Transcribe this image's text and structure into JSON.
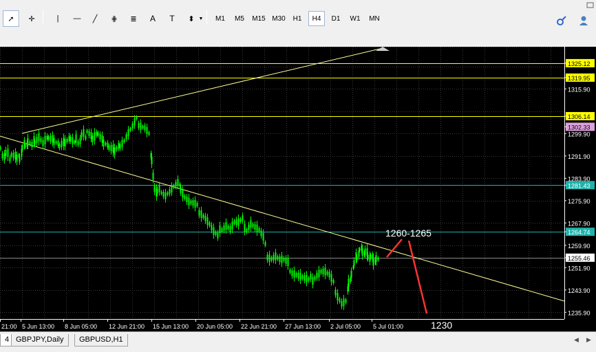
{
  "toolbar": {
    "tools": [
      {
        "name": "cursor-tool",
        "glyph": "➚"
      },
      {
        "name": "crosshair-tool",
        "glyph": "✛"
      },
      {
        "name": "vertical-line-tool",
        "glyph": "|"
      },
      {
        "name": "horizontal-line-tool",
        "glyph": "—"
      },
      {
        "name": "trendline-tool",
        "glyph": "╱"
      },
      {
        "name": "equidistant-channel-tool",
        "glyph": "⋕"
      },
      {
        "name": "fibonacci-tool",
        "glyph": "≣"
      },
      {
        "name": "text-tool",
        "glyph": "A"
      },
      {
        "name": "text-label-tool",
        "glyph": "T"
      },
      {
        "name": "arrows-tool",
        "glyph": "⬍"
      }
    ],
    "timeframes": [
      "M1",
      "M5",
      "M15",
      "M30",
      "H1",
      "H4",
      "D1",
      "W1",
      "MN"
    ],
    "active_timeframe": "H4"
  },
  "chart": {
    "price_labels": [
      {
        "text": "1325.12",
        "bg": "#ffff00",
        "fg": "#000000",
        "price": 1325.12
      },
      {
        "text": "1319.95",
        "bg": "#ffff00",
        "fg": "#000000",
        "price": 1319.95
      },
      {
        "text": "1315.90",
        "bg": "",
        "fg": "#ffffff",
        "price": 1315.9
      },
      {
        "text": "1306.14",
        "bg": "#ffff00",
        "fg": "#000000",
        "price": 1306.14
      },
      {
        "text": "1302.33",
        "bg": "#dda0dd",
        "fg": "#000000",
        "price": 1302.33
      },
      {
        "text": "1299.90",
        "bg": "",
        "fg": "#ffffff",
        "price": 1299.9
      },
      {
        "text": "1291.90",
        "bg": "",
        "fg": "#ffffff",
        "price": 1291.9
      },
      {
        "text": "1283.90",
        "bg": "",
        "fg": "#ffffff",
        "price": 1283.9
      },
      {
        "text": "1281.43",
        "bg": "#20b2aa",
        "fg": "#ffffff",
        "price": 1281.43
      },
      {
        "text": "1275.90",
        "bg": "",
        "fg": "#ffffff",
        "price": 1275.9
      },
      {
        "text": "1267.90",
        "bg": "",
        "fg": "#ffffff",
        "price": 1267.9
      },
      {
        "text": "1264.74",
        "bg": "#20b2aa",
        "fg": "#ffffff",
        "price": 1264.74
      },
      {
        "text": "1259.90",
        "bg": "",
        "fg": "#ffffff",
        "price": 1259.9
      },
      {
        "text": "1255.46",
        "bg": "#ffffff",
        "fg": "#000000",
        "price": 1255.46
      },
      {
        "text": "1251.90",
        "bg": "",
        "fg": "#ffffff",
        "price": 1251.9
      },
      {
        "text": "1243.90",
        "bg": "",
        "fg": "#ffffff",
        "price": 1243.9
      },
      {
        "text": "1235.90",
        "bg": "",
        "fg": "#ffffff",
        "price": 1235.9
      }
    ],
    "time_labels": [
      "21:00",
      "5 Jun 13:00",
      "8 Jun 05:00",
      "12 Jun 21:00",
      "15 Jun 13:00",
      "20 Jun 05:00",
      "22 Jun 21:00",
      "27 Jun 13:00",
      "2 Jul 05:00",
      "5 Jul 01:00"
    ],
    "annotations": {
      "target_label": "1260-1265",
      "target2_label": "1230"
    },
    "colors": {
      "candle": "#00ff00",
      "grid": "#3a3a3a",
      "trendline": "#ffff99",
      "annotation": "#ff3333",
      "cyan_level": "#20b2aa",
      "yellow_level": "#ffff00"
    }
  },
  "tabs": [
    {
      "label": "4",
      "active": true
    },
    {
      "label": "GBPJPY,Daily",
      "active": false
    },
    {
      "label": "GBPUSD,H1",
      "active": false
    }
  ]
}
